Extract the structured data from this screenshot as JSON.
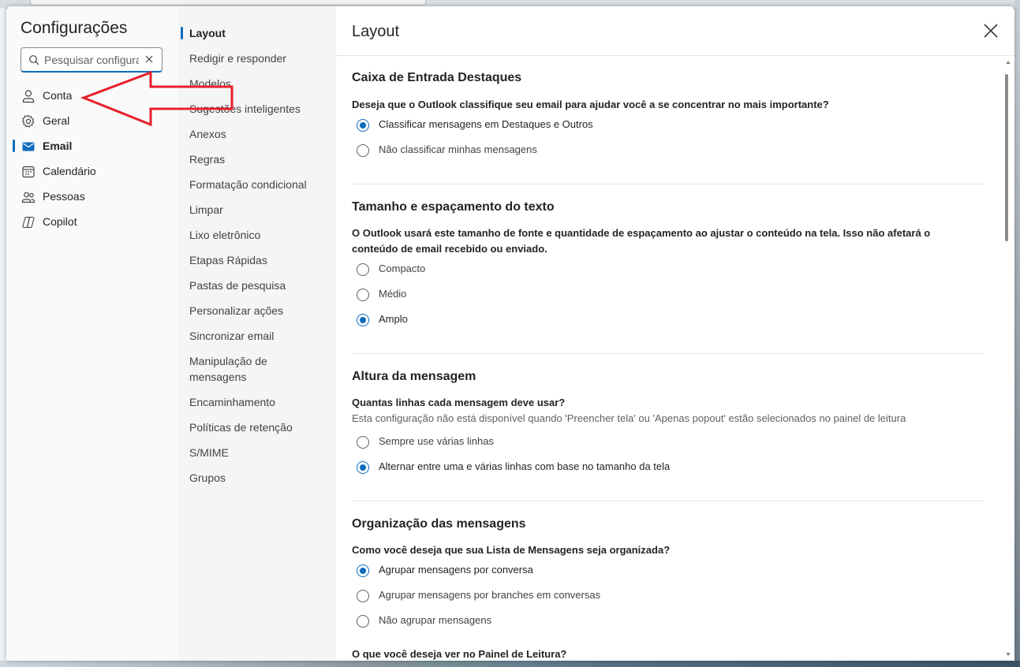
{
  "dialog": {
    "title": "Configurações",
    "close_label": "Fechar"
  },
  "search": {
    "placeholder": "Pesquisar configurações",
    "value": "Pesquisar configura"
  },
  "nav": [
    {
      "label": "Conta",
      "icon": "person-icon"
    },
    {
      "label": "Geral",
      "icon": "gear-icon"
    },
    {
      "label": "Email",
      "icon": "mail-icon",
      "active": true
    },
    {
      "label": "Calendário",
      "icon": "calendar-icon"
    },
    {
      "label": "Pessoas",
      "icon": "people-icon"
    },
    {
      "label": "Copilot",
      "icon": "copilot-icon"
    }
  ],
  "subnav": [
    {
      "label": "Layout",
      "active": true
    },
    {
      "label": "Redigir e responder"
    },
    {
      "label": "Modelos"
    },
    {
      "label": "Sugestões inteligentes"
    },
    {
      "label": "Anexos"
    },
    {
      "label": "Regras"
    },
    {
      "label": "Formatação condicional"
    },
    {
      "label": "Limpar"
    },
    {
      "label": "Lixo eletrônico"
    },
    {
      "label": "Etapas Rápidas"
    },
    {
      "label": "Pastas de pesquisa"
    },
    {
      "label": "Personalizar ações"
    },
    {
      "label": "Sincronizar email"
    },
    {
      "label": "Manipulação de mensagens"
    },
    {
      "label": "Encaminhamento"
    },
    {
      "label": "Políticas de retenção"
    },
    {
      "label": "S/MIME"
    },
    {
      "label": "Grupos"
    }
  ],
  "page": {
    "title": "Layout",
    "sections": [
      {
        "title": "Caixa de Entrada Destaques",
        "question": "Deseja que o Outlook classifique seu email para ajudar você a se concentrar no mais importante?",
        "options": [
          {
            "label": "Classificar mensagens em Destaques e Outros",
            "checked": true
          },
          {
            "label": "Não classificar minhas mensagens",
            "checked": false
          }
        ]
      },
      {
        "title": "Tamanho e espaçamento do texto",
        "question": "O Outlook usará este tamanho de fonte e quantidade de espaçamento ao ajustar o conteúdo na tela. Isso não afetará o conteúdo de email recebido ou enviado.",
        "options": [
          {
            "label": "Compacto",
            "checked": false
          },
          {
            "label": "Médio",
            "checked": false
          },
          {
            "label": "Amplo",
            "checked": true
          }
        ]
      },
      {
        "title": "Altura da mensagem",
        "question": "Quantas linhas cada mensagem deve usar?",
        "note": "Esta configuração não está disponível quando 'Preencher tela' ou 'Apenas popout' estão selecionados no painel de leitura",
        "options": [
          {
            "label": "Sempre use várias linhas",
            "checked": false
          },
          {
            "label": "Alternar entre uma e várias linhas com base no tamanho da tela",
            "checked": true
          }
        ]
      },
      {
        "title": "Organização das mensagens",
        "question": "Como você deseja que sua Lista de Mensagens seja organizada?",
        "options": [
          {
            "label": "Agrupar mensagens por conversa",
            "checked": true
          },
          {
            "label": "Agrupar mensagens por branches em conversas",
            "checked": false
          },
          {
            "label": "Não agrupar mensagens",
            "checked": false
          }
        ]
      },
      {
        "question": "O que você deseja ver no Painel de Leitura?"
      }
    ]
  },
  "colors": {
    "accent": "#0f6cbd",
    "annotation_arrow": "#e8202a"
  }
}
